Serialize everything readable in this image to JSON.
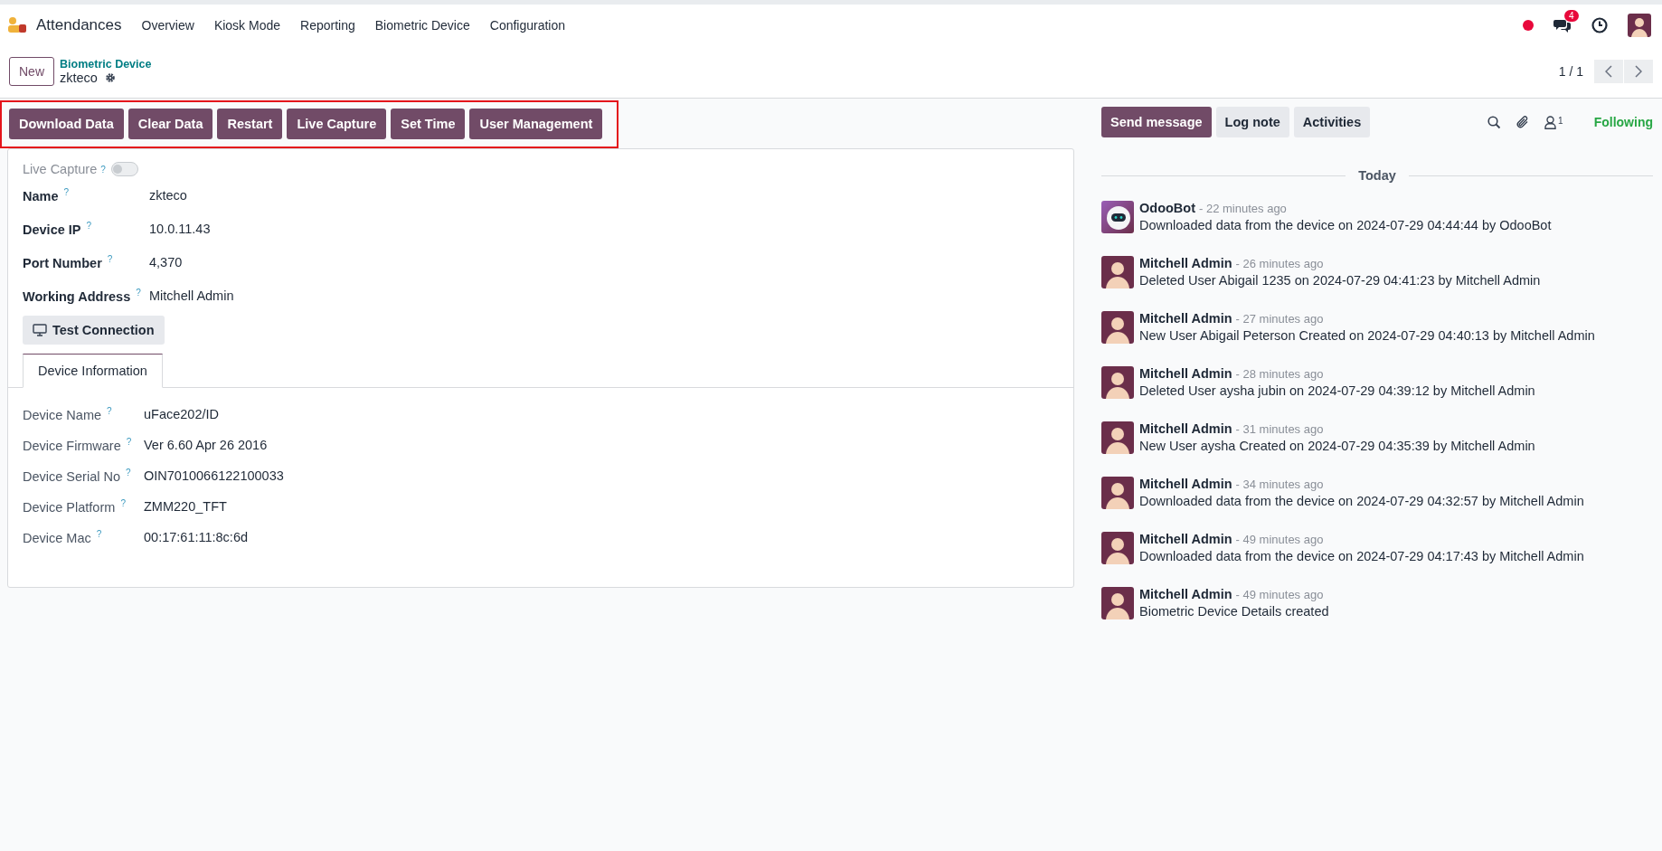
{
  "app": {
    "name": "Attendances"
  },
  "menu": [
    "Overview",
    "Kiosk Mode",
    "Reporting",
    "Biometric Device",
    "Configuration"
  ],
  "systray": {
    "recording": true,
    "message_count": "4"
  },
  "control_panel": {
    "new_button": "New",
    "breadcrumb": "Biometric Device",
    "record": "zkteco",
    "pager": "1 / 1"
  },
  "actions": {
    "highlighted": true,
    "buttons": [
      "Download Data",
      "Clear Data",
      "Restart",
      "Live Capture",
      "Set Time",
      "User Management"
    ]
  },
  "form": {
    "live_capture": {
      "label": "Live Capture",
      "help": "?",
      "on": false
    },
    "fields": [
      {
        "label": "Name",
        "help": "?",
        "value": "zkteco"
      },
      {
        "label": "Device IP",
        "help": "?",
        "value": "10.0.11.43"
      },
      {
        "label": "Port Number",
        "help": "?",
        "value": "4,370"
      },
      {
        "label": "Working Address",
        "help": "?",
        "value": "Mitchell Admin"
      }
    ],
    "test_button": "Test Connection",
    "tabs": [
      {
        "label": "Device Information",
        "selected": true
      }
    ],
    "info_fields": [
      {
        "label": "Device Name",
        "help": "?",
        "value": "uFace202/ID"
      },
      {
        "label": "Device Firmware",
        "help": "?",
        "value": "Ver 6.60 Apr 26 2016"
      },
      {
        "label": "Device Serial No",
        "help": "?",
        "value": "OIN7010066122100033"
      },
      {
        "label": "Device Platform",
        "help": "?",
        "value": "ZMM220_TFT"
      },
      {
        "label": "Device Mac",
        "help": "?",
        "value": "00:17:61:11:8c:6d"
      }
    ]
  },
  "chatter": {
    "buttons": [
      {
        "label": "Send message",
        "kind": "primary"
      },
      {
        "label": "Log note",
        "kind": "secondary"
      },
      {
        "label": "Activities",
        "kind": "secondary"
      }
    ],
    "follower_count": "1",
    "follow_status": "Following",
    "date_separator": "Today",
    "messages": [
      {
        "author": "OdooBot",
        "kind": "bot",
        "time": "- 22 minutes ago",
        "body": "Downloaded data from the device on 2024-07-29 04:44:44 by OdooBot"
      },
      {
        "author": "Mitchell Admin",
        "kind": "user",
        "time": "- 26 minutes ago",
        "body": "Deleted User Abigail 1235 on 2024-07-29 04:41:23 by Mitchell Admin"
      },
      {
        "author": "Mitchell Admin",
        "kind": "user",
        "time": "- 27 minutes ago",
        "body": "New User Abigail Peterson Created on 2024-07-29 04:40:13 by Mitchell Admin"
      },
      {
        "author": "Mitchell Admin",
        "kind": "user",
        "time": "- 28 minutes ago",
        "body": "Deleted User aysha jubin on 2024-07-29 04:39:12 by Mitchell Admin"
      },
      {
        "author": "Mitchell Admin",
        "kind": "user",
        "time": "- 31 minutes ago",
        "body": "New User aysha Created on 2024-07-29 04:35:39 by Mitchell Admin"
      },
      {
        "author": "Mitchell Admin",
        "kind": "user",
        "time": "- 34 minutes ago",
        "body": "Downloaded data from the device on 2024-07-29 04:32:57 by Mitchell Admin"
      },
      {
        "author": "Mitchell Admin",
        "kind": "user",
        "time": "- 49 minutes ago",
        "body": "Downloaded data from the device on 2024-07-29 04:17:43 by Mitchell Admin"
      },
      {
        "author": "Mitchell Admin",
        "kind": "user",
        "time": "- 49 minutes ago",
        "body": "Biometric Device Details created"
      }
    ]
  }
}
